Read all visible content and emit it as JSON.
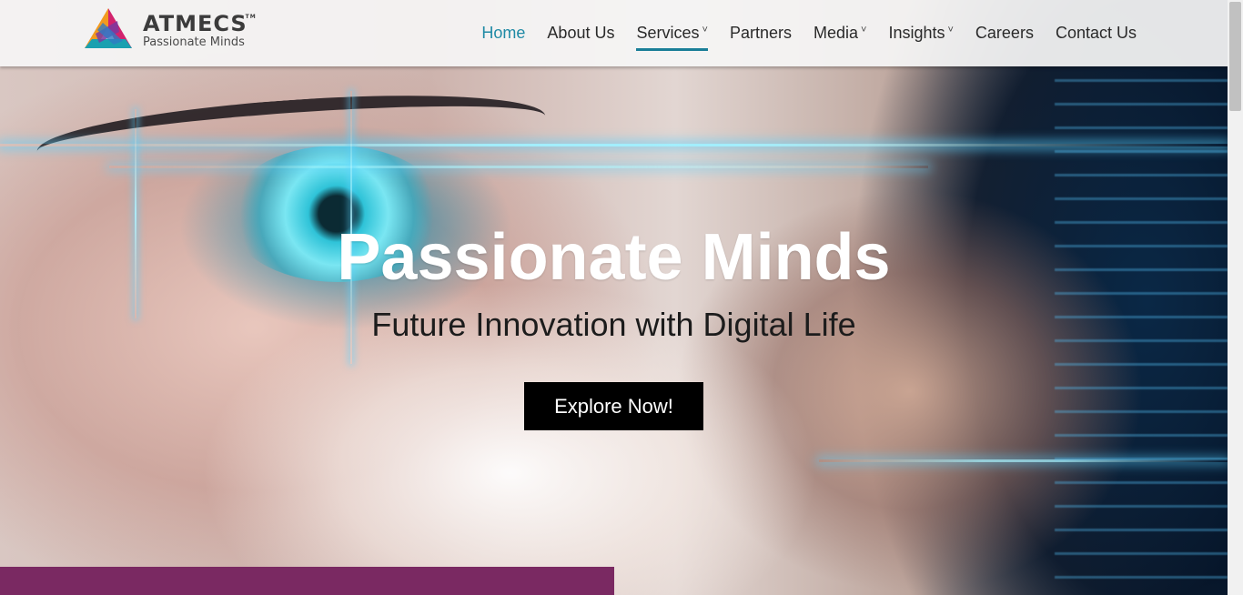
{
  "brand": {
    "name": "ATMECS",
    "trademark": "TM",
    "tagline": "Passionate Minds"
  },
  "nav": {
    "items": [
      {
        "label": "Home",
        "dropdown": false
      },
      {
        "label": "About Us",
        "dropdown": false
      },
      {
        "label": "Services",
        "dropdown": true
      },
      {
        "label": "Partners",
        "dropdown": false
      },
      {
        "label": "Media",
        "dropdown": true
      },
      {
        "label": "Insights",
        "dropdown": true
      },
      {
        "label": "Careers",
        "dropdown": false
      },
      {
        "label": "Contact Us",
        "dropdown": false
      }
    ],
    "chevron_glyph": "˅"
  },
  "hero": {
    "title": "Passionate Minds",
    "subtitle": "Future Innovation with Digital Life",
    "cta_label": "Explore Now!"
  },
  "colors": {
    "accent": "#1f8aa5",
    "cta_bg": "#000000",
    "band": "#7a2962"
  }
}
